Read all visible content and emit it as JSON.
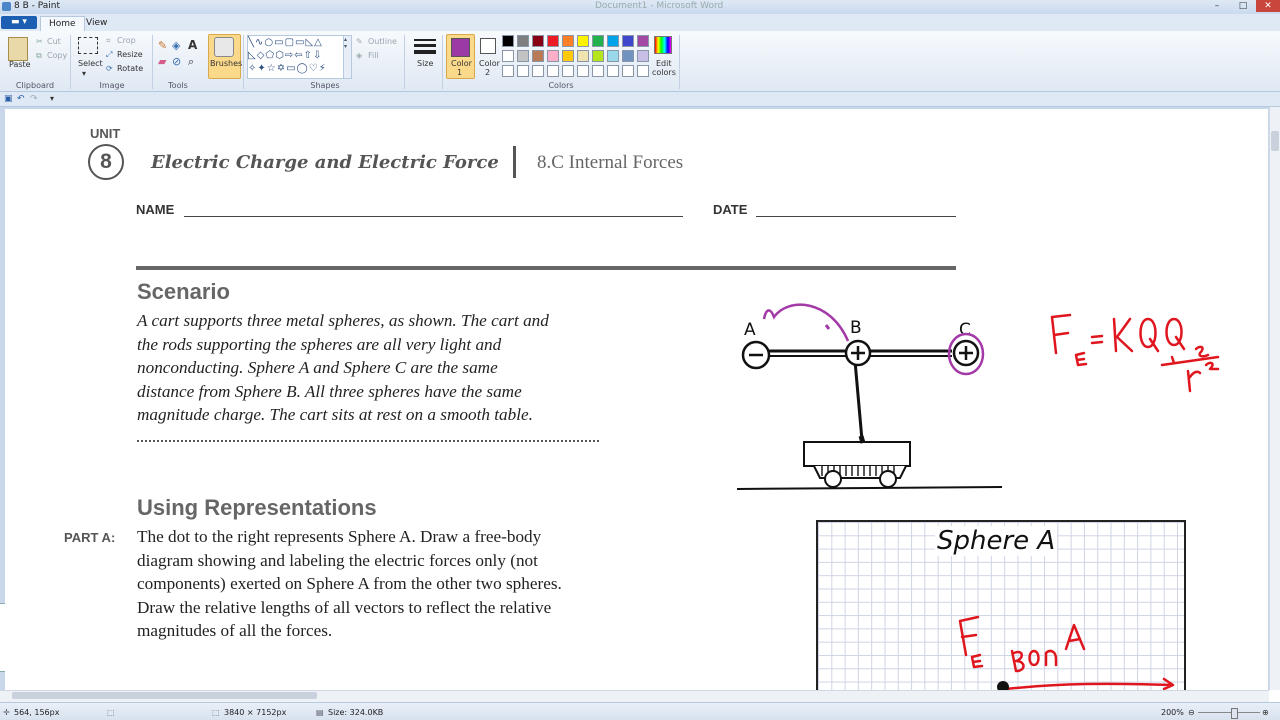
{
  "window": {
    "title": "8 B - Paint",
    "inactive_title": "Document1 - Microsoft Word",
    "controls": [
      "–",
      "□",
      "✕"
    ]
  },
  "ribbon": {
    "tabs": [
      "Home",
      "View"
    ],
    "clipboard": {
      "paste": "Paste",
      "cut": "Cut",
      "copy": "Copy",
      "group": "Clipboard"
    },
    "image": {
      "select": "Select",
      "crop": "Crop",
      "resize": "Resize",
      "rotate": "Rotate",
      "group": "Image"
    },
    "tools": {
      "group": "Tools",
      "text_tool": "A"
    },
    "brushes": {
      "label": "Brushes"
    },
    "shapes": {
      "group": "Shapes",
      "outline": "Outline",
      "fill": "Fill"
    },
    "size": {
      "label": "Size"
    },
    "colors": {
      "color1_label": "Color",
      "color1_num": "1",
      "color2_label": "Color",
      "color2_num": "2",
      "edit_label": "Edit",
      "edit_label2": "colors",
      "group": "Colors",
      "color1": "#9b3aa5",
      "color2": "#ffffff",
      "palette_row1": [
        "#000000",
        "#7f7f7f",
        "#880015",
        "#ed1c24",
        "#ff7f27",
        "#fff200",
        "#22b14c",
        "#00a2e8",
        "#3f48cc",
        "#a349a4"
      ],
      "palette_row2": [
        "#ffffff",
        "#c3c3c3",
        "#b97a57",
        "#ffaec9",
        "#ffc90e",
        "#efe4b0",
        "#b5e61d",
        "#99d9ea",
        "#7092be",
        "#c8bfe7"
      ]
    }
  },
  "document": {
    "unit_label": "UNIT",
    "unit_number": "8",
    "chapter": "Electric Charge and Electric Force",
    "topic": "8.C Internal Forces",
    "name_label": "NAME",
    "date_label": "DATE",
    "scenario_header": "Scenario",
    "scenario_lines": [
      "A cart supports three metal spheres, as shown. The cart and",
      "the rods supporting the spheres are all very light and",
      "nonconducting. Sphere A  and Sphere C are the same",
      "distance from Sphere B. All three spheres have the same",
      "magnitude charge. The cart sits at rest on a smooth table."
    ],
    "using_header": "Using Representations",
    "part_a_label": "PART A:",
    "part_a_lines": [
      "The dot to the right represents Sphere A. Draw a free-body",
      "diagram showing and labeling the electric forces only (not",
      "components) exerted on Sphere A from the other two spheres.",
      "Draw the relative lengths of all vectors to reflect the relative",
      "magnitudes of all the forces."
    ],
    "diagram_labels": {
      "a": "A",
      "b": "B",
      "c": "C"
    },
    "grid_title": "Sphere A",
    "annotation_color": "#e0161e",
    "highlight_color": "#a33aa8"
  },
  "status": {
    "cursor_pos": "564, 156px",
    "image_size": "3840 × 7152px",
    "file_size": "Size: 324.0KB",
    "zoom": "200%"
  }
}
